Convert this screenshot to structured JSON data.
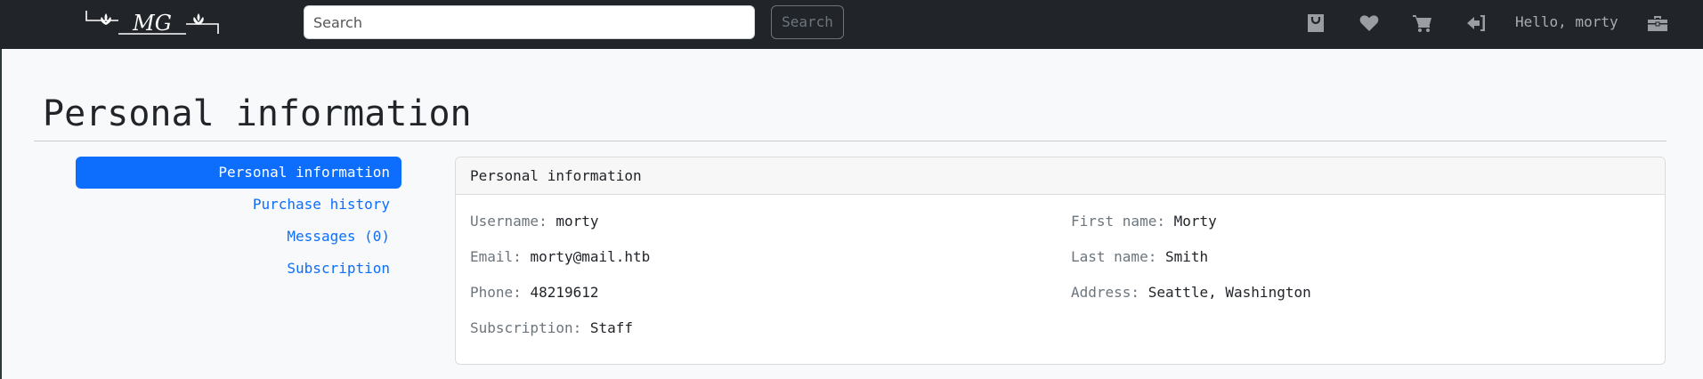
{
  "navbar": {
    "logo_text": "MG",
    "search_placeholder": "Search",
    "search_button": "Search",
    "greeting": "Hello, morty",
    "icons": [
      "shopping-bag-icon",
      "heart-icon",
      "cart-icon",
      "sign-out-icon",
      "briefcase-icon"
    ]
  },
  "page": {
    "title": "Personal information"
  },
  "side_nav": {
    "items": [
      {
        "label": "Personal information",
        "active": true
      },
      {
        "label": "Purchase history",
        "active": false
      },
      {
        "label": "Messages (0)",
        "active": false
      },
      {
        "label": "Subscription",
        "active": false
      }
    ]
  },
  "card": {
    "header": "Personal information",
    "fields": {
      "username": {
        "label": "Username:",
        "value": "morty"
      },
      "email": {
        "label": "Email:",
        "value": "morty@mail.htb"
      },
      "phone": {
        "label": "Phone:",
        "value": "48219612"
      },
      "subscription": {
        "label": "Subscription:",
        "value": "Staff"
      },
      "first_name": {
        "label": "First name:",
        "value": "Morty"
      },
      "last_name": {
        "label": "Last name:",
        "value": "Smith"
      },
      "address": {
        "label": "Address:",
        "value": "Seattle, Washington"
      }
    }
  },
  "colors": {
    "navbar_bg": "#212529",
    "primary": "#0d6efd",
    "page_bg": "#f8f9fa",
    "muted": "#6c757d"
  }
}
